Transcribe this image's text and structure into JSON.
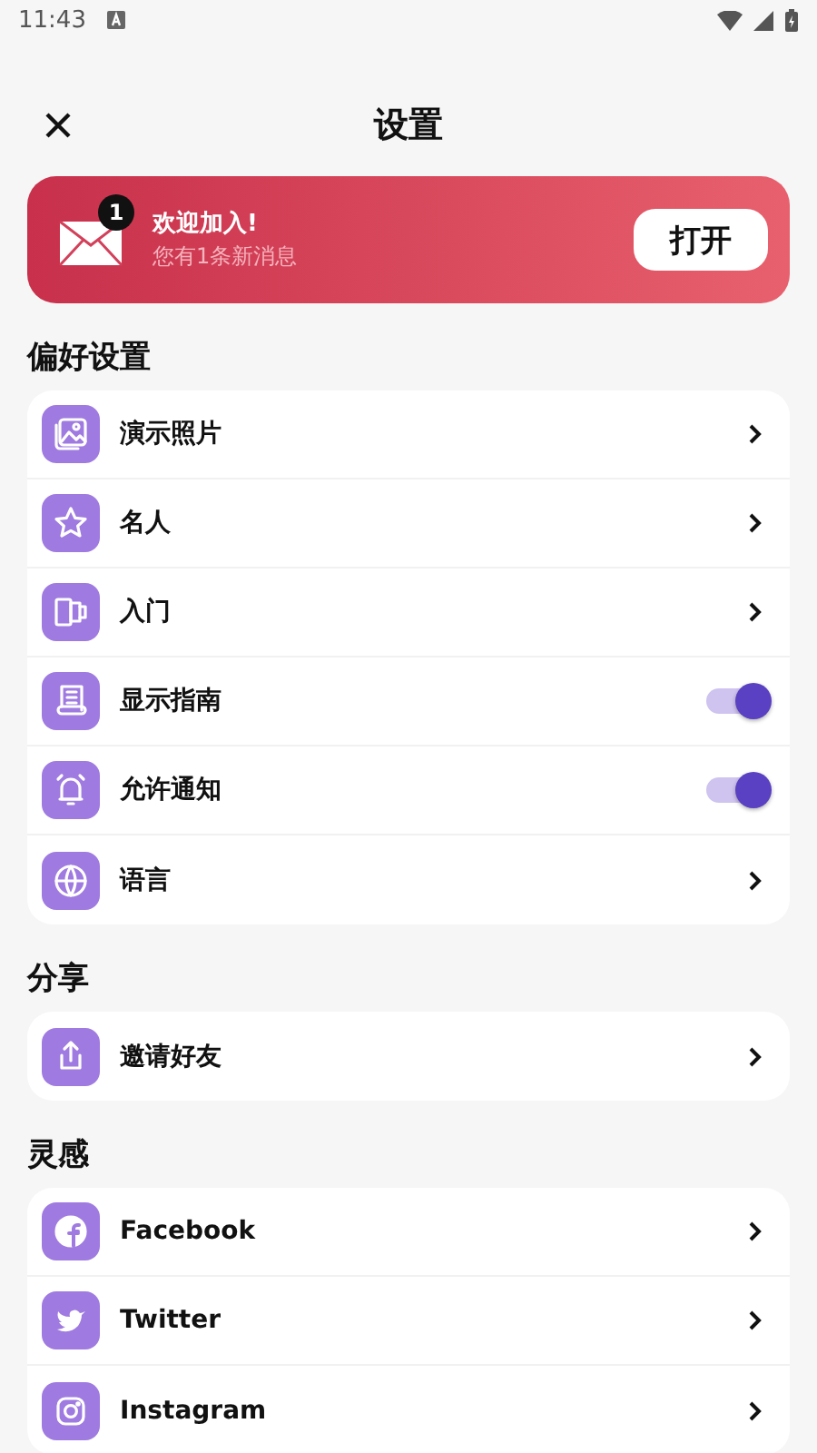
{
  "status_bar": {
    "time": "11:43"
  },
  "header": {
    "title": "设置"
  },
  "banner": {
    "badge": "1",
    "title": "欢迎加入!",
    "subtitle": "您有1条新消息",
    "button": "打开"
  },
  "sections": [
    {
      "title": "偏好设置",
      "items": [
        {
          "label": "演示照片",
          "kind": "link"
        },
        {
          "label": "名人",
          "kind": "link"
        },
        {
          "label": "入门",
          "kind": "link"
        },
        {
          "label": "显示指南",
          "kind": "toggle",
          "on": true
        },
        {
          "label": "允许通知",
          "kind": "toggle",
          "on": true
        },
        {
          "label": "语言",
          "kind": "link"
        }
      ]
    },
    {
      "title": "分享",
      "items": [
        {
          "label": "邀请好友",
          "kind": "link"
        }
      ]
    },
    {
      "title": "灵感",
      "items": [
        {
          "label": "Facebook",
          "kind": "link"
        },
        {
          "label": "Twitter",
          "kind": "link"
        },
        {
          "label": "Instagram",
          "kind": "link"
        }
      ]
    }
  ]
}
